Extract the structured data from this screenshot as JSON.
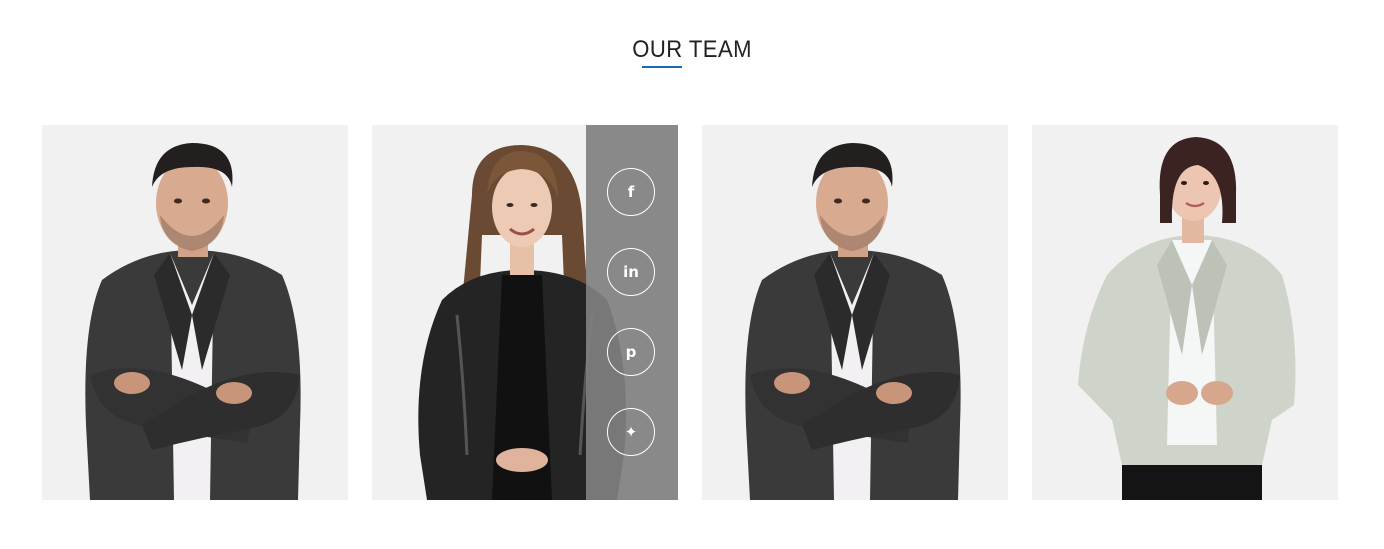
{
  "section": {
    "title": "OUR TEAM",
    "accent_color": "#1a6bb5"
  },
  "team": {
    "members": [
      {
        "portrait": "man-in-dark-suit-arms-crossed"
      },
      {
        "portrait": "woman-in-leather-jacket-smiling"
      },
      {
        "portrait": "man-in-dark-suit-arms-crossed"
      },
      {
        "portrait": "woman-in-light-blazer"
      }
    ],
    "social_panel_bg": "#8c8c8c",
    "social_links": [
      {
        "icon": "facebook-icon",
        "glyph": "f"
      },
      {
        "icon": "linkedin-icon",
        "glyph": "in"
      },
      {
        "icon": "pinterest-icon",
        "glyph": "p"
      },
      {
        "icon": "twitter-icon",
        "glyph": "✦"
      }
    ]
  }
}
